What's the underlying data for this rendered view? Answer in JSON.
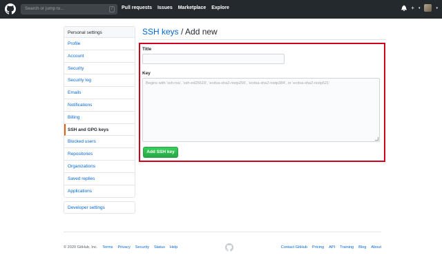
{
  "header": {
    "search_placeholder": "Search or jump to...",
    "slash_key": "/",
    "nav": [
      "Pull requests",
      "Issues",
      "Marketplace",
      "Explore"
    ],
    "icons": [
      "bell-icon",
      "plus-icon",
      "avatar"
    ]
  },
  "sidebar": {
    "heading": "Personal settings",
    "items": [
      "Profile",
      "Account",
      "Security",
      "Security log",
      "Emails",
      "Notifications",
      "Billing",
      "SSH and GPG keys",
      "Blocked users",
      "Repositories",
      "Organizations",
      "Saved replies",
      "Applications"
    ],
    "selected": "SSH and GPG keys",
    "developer": "Developer settings"
  },
  "main": {
    "title_link": "SSH keys",
    "title_rest": " / Add new",
    "title_label": "Title",
    "key_label": "Key",
    "key_placeholder": "Begins with 'ssh-rsa', 'ssh-ed25519', 'ecdsa-sha2-nistp256', 'ecdsa-sha2-nistp384', or 'ecdsa-sha2-nistp521'",
    "add_button": "Add SSH key"
  },
  "footer": {
    "copyright": "© 2020 GitHub, Inc.",
    "left_links": [
      "Terms",
      "Privacy",
      "Security",
      "Status",
      "Help"
    ],
    "right_links": [
      "Contact GitHub",
      "Pricing",
      "API",
      "Training",
      "Blog",
      "About"
    ]
  },
  "colors": {
    "accent": "#0366d6",
    "header": "#24292e",
    "highlight": "#d0021b",
    "button": "#28a745"
  }
}
